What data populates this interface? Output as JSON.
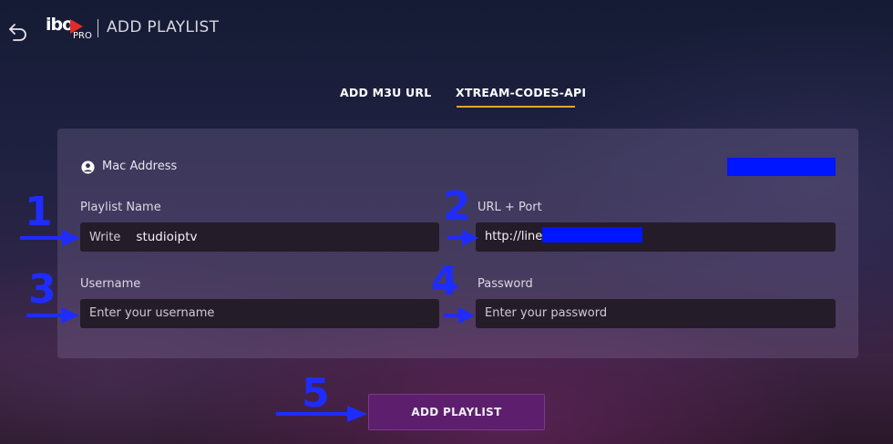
{
  "header": {
    "logo_text": "ibo",
    "logo_pro": "PRO",
    "title": "ADD PLAYLIST"
  },
  "tabs": [
    {
      "label": "ADD M3U URL",
      "active": false
    },
    {
      "label": "XTREAM-CODES-API",
      "active": true
    }
  ],
  "form": {
    "mac_label": "Mac Address",
    "playlist_name": {
      "label": "Playlist Name",
      "prefix": "Write",
      "value": "studioiptv"
    },
    "url_port": {
      "label": "URL + Port",
      "value": "http://line"
    },
    "username": {
      "label": "Username",
      "placeholder": "Enter your username"
    },
    "password": {
      "label": "Password",
      "placeholder": "Enter your password"
    }
  },
  "submit_label": "ADD PLAYLIST",
  "annotations": [
    "1",
    "2",
    "3",
    "4",
    "5"
  ],
  "colors": {
    "accent_underline": "#f2a228",
    "button": "#5d1e6e",
    "annotation_blue": "#1f2cff",
    "redaction": "#0016ff"
  },
  "icons": [
    "back-arrow-icon",
    "logo-play-icon",
    "person-icon"
  ]
}
